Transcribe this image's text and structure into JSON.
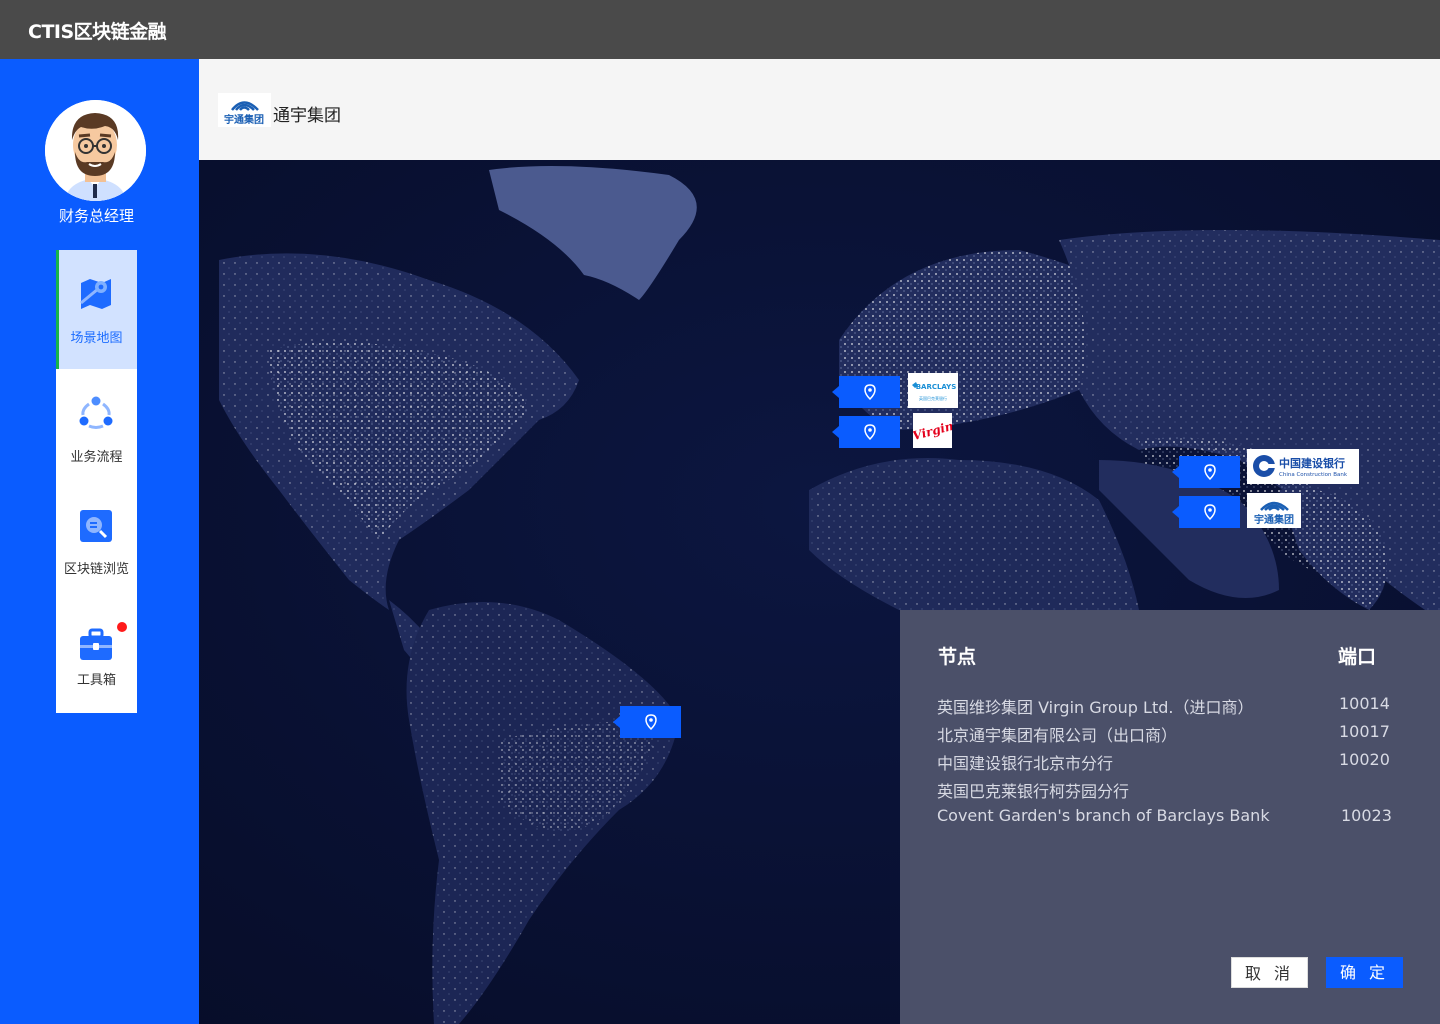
{
  "app": {
    "brand": "CTIS区块链金融"
  },
  "user": {
    "role": "财务总经理"
  },
  "nav": {
    "items": [
      {
        "label": "场景地图",
        "icon": "map-icon",
        "active": true
      },
      {
        "label": "业务流程",
        "icon": "flow-icon",
        "active": false
      },
      {
        "label": "区块链浏览",
        "icon": "browser-search-icon",
        "active": false
      },
      {
        "label": "工具箱",
        "icon": "toolbox-icon",
        "active": false,
        "badge": true
      }
    ]
  },
  "header": {
    "company_name": "通宇集团",
    "logo_text": "宇通集团"
  },
  "map": {
    "markers": [
      {
        "name": "barclays",
        "logo_text": "BARCLAYS",
        "logo_subtext": "英国巴克莱银行"
      },
      {
        "name": "virgin",
        "logo_text": "Virgin"
      },
      {
        "name": "ccb",
        "logo_text": "中国建设银行",
        "logo_subtext": "China Construction Bank"
      },
      {
        "name": "yutong",
        "logo_text": "宇通集团"
      },
      {
        "name": "brazil"
      }
    ]
  },
  "panel": {
    "col_node": "节点",
    "col_port": "端口",
    "rows": [
      {
        "node": "英国维珍集团 Virgin Group Ltd.（进口商）",
        "port": "10014"
      },
      {
        "node": "北京通宇集团有限公司（出口商）",
        "port": "10017"
      },
      {
        "node": "中国建设银行北京市分行",
        "port": "10020"
      },
      {
        "node": "英国巴克莱银行柯芬园分行",
        "port": ""
      },
      {
        "node": "Covent Garden's branch of Barclays Bank",
        "port": "10023"
      }
    ],
    "cancel_label": "取 消",
    "confirm_label": "确 定"
  },
  "colors": {
    "accent": "#0a5cff",
    "active_bar": "#17b34a",
    "panel_bg": "#4b5069",
    "topbar": "#4a4a4a"
  }
}
